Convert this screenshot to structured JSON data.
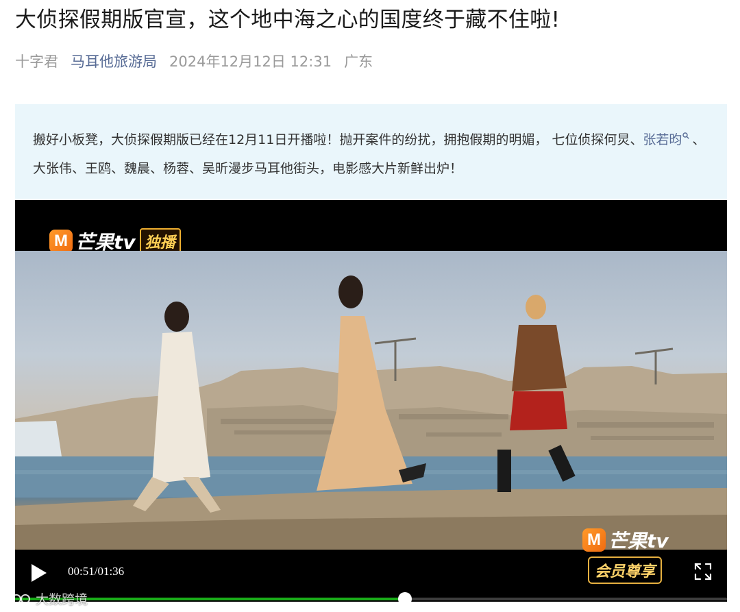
{
  "article": {
    "title": "大侦探假期版官宣，这个地中海之心的国度终于藏不住啦!",
    "author": "十字君",
    "account": "马耳他旅游局",
    "date": "2024年12月12日 12:31",
    "location": "广东"
  },
  "summary": {
    "text_before": "搬好小板凳，大侦探假期版已经在12月11日开播啦！抛开案件的纷扰，拥抱假期的明媚， 七位侦探何炅、",
    "link": "张若昀",
    "text_after": "、大张伟、王鸥、魏晨、杨蓉、吴昕漫步马耳他街头，电影感大片新鲜出炉！"
  },
  "video": {
    "brand_badge": "M",
    "brand_name": "芒果tv",
    "exclusive_label": "独播",
    "vip_label": "会员尊享",
    "current_time": "00:51",
    "duration": "01:36",
    "time_display": "00:51/01:36",
    "progress": 0.548
  },
  "watermark": {
    "text": "大数跨境"
  },
  "colors": {
    "link": "#576b95",
    "summary_bg": "#eaf6fb",
    "progress": "#1aad19",
    "brand_orange": "#f07c16"
  },
  "icons": [
    "search-icon",
    "play-icon",
    "fullscreen-icon",
    "watermark-logo-icon"
  ]
}
